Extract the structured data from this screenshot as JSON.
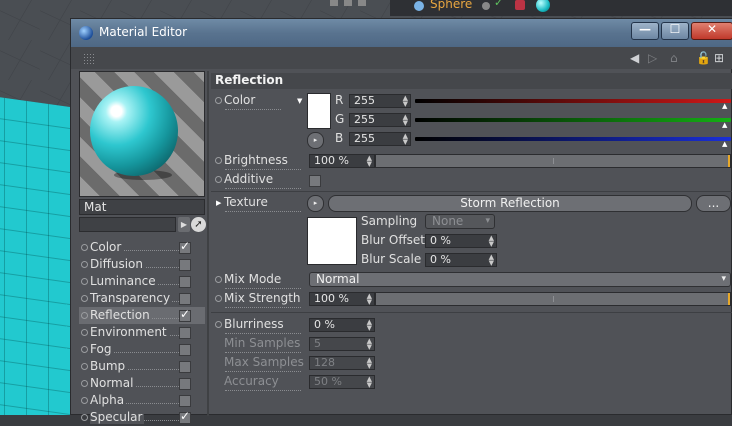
{
  "background": {
    "object_manager": {
      "object_name": "Sphere"
    }
  },
  "window": {
    "title": "Material Editor",
    "buttons": {
      "minimize": "—",
      "maximize": "☐",
      "close": "✕"
    },
    "nav": {
      "back": "◀",
      "forward": "▷",
      "up": "⌂",
      "lock": "🔓",
      "new": "⊞"
    }
  },
  "left": {
    "material_name": "Mat",
    "channels": [
      {
        "label": "Color",
        "checked": true
      },
      {
        "label": "Diffusion",
        "checked": false
      },
      {
        "label": "Luminance",
        "checked": false
      },
      {
        "label": "Transparency",
        "checked": false
      },
      {
        "label": "Reflection",
        "checked": true,
        "active": true
      },
      {
        "label": "Environment",
        "checked": false
      },
      {
        "label": "Fog",
        "checked": false
      },
      {
        "label": "Bump",
        "checked": false
      },
      {
        "label": "Normal",
        "checked": false
      },
      {
        "label": "Alpha",
        "checked": false
      },
      {
        "label": "Specular",
        "checked": true
      }
    ]
  },
  "reflection": {
    "section_title": "Reflection",
    "color": {
      "label": "Color",
      "swatch": "#ffffff",
      "r_label": "R",
      "r_value": "255",
      "g_label": "G",
      "g_value": "255",
      "b_label": "B",
      "b_value": "255"
    },
    "brightness": {
      "label": "Brightness",
      "value": "100 %",
      "fraction": 1.0
    },
    "additive": {
      "label": "Additive",
      "checked": false
    },
    "texture": {
      "label": "Texture",
      "name": "Storm Reflection",
      "more": "...",
      "sampling_label": "Sampling",
      "sampling_value": "None",
      "blur_offset_label": "Blur Offset",
      "blur_offset_value": "0 %",
      "blur_scale_label": "Blur Scale",
      "blur_scale_value": "0 %"
    },
    "mix_mode": {
      "label": "Mix Mode",
      "value": "Normal"
    },
    "mix_strength": {
      "label": "Mix Strength",
      "value": "100 %",
      "fraction": 1.0
    },
    "blurriness": {
      "label": "Blurriness",
      "value": "0 %"
    },
    "min_samples": {
      "label": "Min Samples",
      "value": "5"
    },
    "max_samples": {
      "label": "Max Samples",
      "value": "128"
    },
    "accuracy": {
      "label": "Accuracy",
      "value": "50 %"
    }
  },
  "colors": {
    "accent_orange": "#e8a92a",
    "red_bar": "#d01818",
    "green_bar": "#14b014",
    "blue_bar": "#1a2fd8",
    "cyan_object": "#22c9cf"
  }
}
